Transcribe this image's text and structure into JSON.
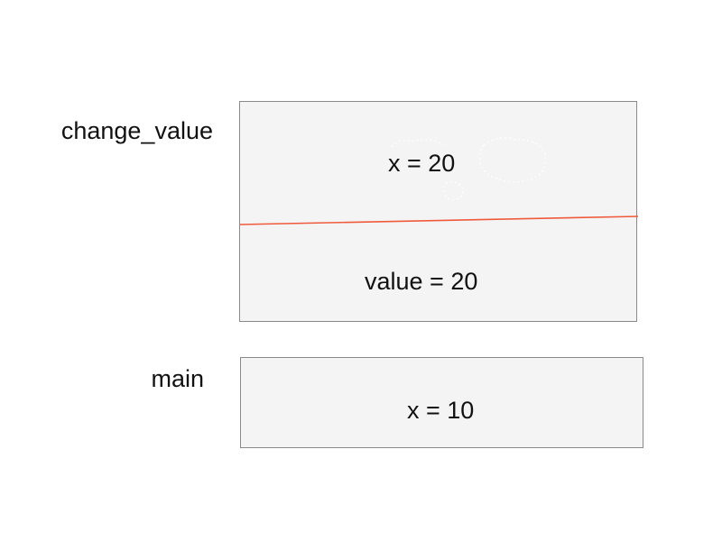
{
  "frames": {
    "change_value": {
      "label": "change_value",
      "vars": {
        "x": "x = 20",
        "value": "value = 20"
      },
      "divider_color": "#f05a3c"
    },
    "main": {
      "label": "main",
      "vars": {
        "x": "x = 10"
      }
    }
  },
  "colors": {
    "frame_fill": "#f4f4f4",
    "frame_border": "#8a8a8a",
    "text": "#111111",
    "divider": "#f05a3c"
  }
}
